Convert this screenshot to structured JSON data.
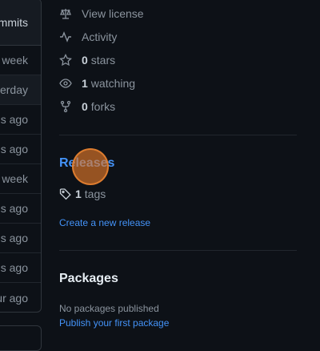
{
  "commit_list": {
    "header": "mmits",
    "rows": [
      {
        "text": "week"
      },
      {
        "text": "erday"
      },
      {
        "text": "s ago"
      },
      {
        "text": "s ago"
      },
      {
        "text": "week"
      },
      {
        "text": "s ago"
      },
      {
        "text": "s ago"
      },
      {
        "text": "s ago"
      },
      {
        "text": "ur ago"
      }
    ]
  },
  "about": {
    "license_label": "View license",
    "activity_label": "Activity",
    "stars_count": "0",
    "stars_label": "stars",
    "watching_count": "1",
    "watching_label": "watching",
    "forks_count": "0",
    "forks_label": "forks"
  },
  "releases": {
    "title": "Releases",
    "tags_count": "1",
    "tags_label": "tags",
    "create_link": "Create a new release"
  },
  "packages": {
    "title": "Packages",
    "empty_text": "No packages published",
    "publish_link": "Publish your first package"
  },
  "colors": {
    "background": "#0d1117",
    "link": "#4493f8",
    "muted": "#8b949e",
    "cursor_overlay": "#e17828"
  }
}
